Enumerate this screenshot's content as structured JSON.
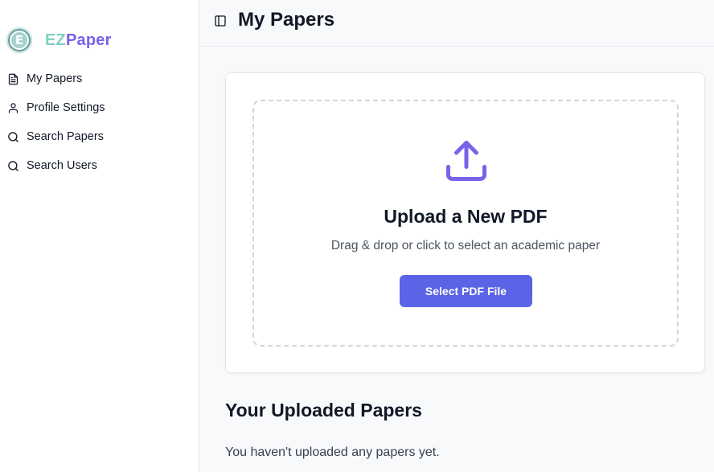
{
  "brand": {
    "logo_letter": "E",
    "name_part1": "EZ",
    "name_part2": "Paper"
  },
  "sidebar": {
    "items": [
      {
        "label": "My Papers",
        "icon": "document-icon"
      },
      {
        "label": "Profile Settings",
        "icon": "user-icon"
      },
      {
        "label": "Search Papers",
        "icon": "search-icon"
      },
      {
        "label": "Search Users",
        "icon": "search-icon"
      }
    ]
  },
  "header": {
    "title": "My Papers",
    "toggle_icon": "sidebar-toggle-icon"
  },
  "upload": {
    "icon": "upload-icon",
    "title": "Upload a New PDF",
    "subtitle": "Drag & drop or click to select an academic paper",
    "button_label": "Select PDF File"
  },
  "papers": {
    "section_title": "Your Uploaded Papers",
    "empty_message": "You haven't uploaded any papers yet."
  },
  "colors": {
    "accent": "#5b63e6",
    "brand_teal": "#7ecfc0",
    "brand_purple": "#7b61e8",
    "upload_icon": "#7b61e8"
  }
}
